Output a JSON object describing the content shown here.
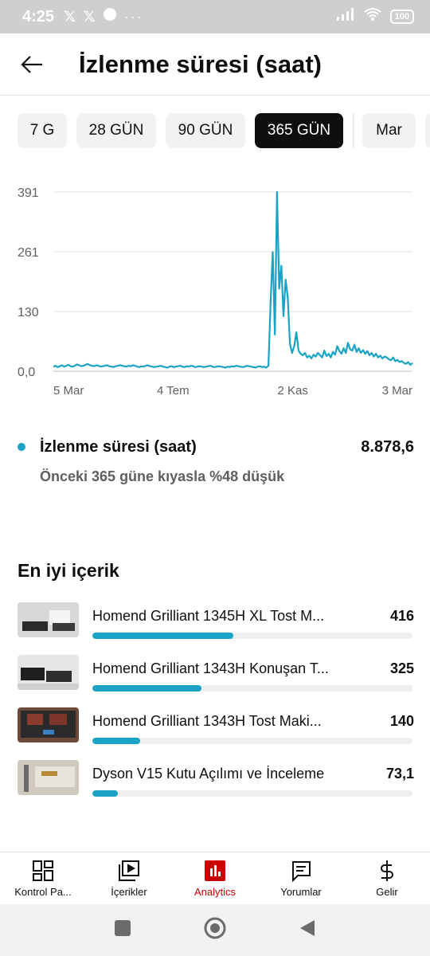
{
  "status_bar": {
    "time": "4:25",
    "x_icon_1": "𝕏",
    "x_icon_2": "𝕏",
    "more": "···",
    "battery": "100"
  },
  "header": {
    "title": "İzlenme süresi (saat)"
  },
  "chips": [
    {
      "label": "7 G",
      "active": false
    },
    {
      "label": "28 GÜN",
      "active": false
    },
    {
      "label": "90 GÜN",
      "active": false
    },
    {
      "label": "365 GÜN",
      "active": true
    },
    {
      "label": "Mar",
      "active": false
    }
  ],
  "chart_data": {
    "type": "line",
    "title": "",
    "xlabel": "",
    "ylabel": "",
    "y_ticks": [
      "391",
      "261",
      "130",
      "0,0"
    ],
    "x_ticks": [
      "5 Mar",
      "4 Tem",
      "2 Kas",
      "3 Mar"
    ],
    "ylim": [
      0,
      391
    ],
    "grid": true,
    "color": "#1aa3c4",
    "series": [
      {
        "values": [
          10,
          12,
          9,
          11,
          13,
          10,
          12,
          14,
          11,
          10,
          12,
          15,
          13,
          11,
          12,
          14,
          16,
          13,
          12,
          11,
          13,
          12,
          10,
          11,
          12,
          13,
          11,
          10,
          9,
          11,
          12,
          13,
          12,
          11,
          10,
          12,
          11,
          13,
          12,
          10,
          9,
          11,
          10,
          12,
          13,
          11,
          10,
          9,
          10,
          11,
          12,
          10,
          9,
          8,
          10,
          11,
          9,
          10,
          11,
          12,
          10,
          9,
          11,
          10,
          12,
          11,
          9,
          10,
          11,
          10,
          9,
          10,
          11,
          12,
          10,
          9,
          10,
          11,
          10,
          9,
          8,
          10,
          9,
          11,
          10,
          12,
          11,
          10,
          9,
          10,
          12,
          11,
          10,
          9,
          8,
          10,
          11,
          9,
          10,
          8,
          12,
          150,
          260,
          80,
          391,
          180,
          230,
          120,
          200,
          160,
          60,
          40,
          55,
          85,
          45,
          38,
          35,
          40,
          30,
          34,
          28,
          36,
          32,
          40,
          35,
          30,
          45,
          33,
          38,
          30,
          42,
          36,
          55,
          44,
          38,
          50,
          40,
          62,
          48,
          45,
          58,
          42,
          50,
          40,
          46,
          38,
          44,
          35,
          40,
          32,
          38,
          30,
          34,
          28,
          32,
          30,
          26,
          24,
          30,
          22,
          25,
          20,
          22,
          18,
          16,
          20,
          14,
          18
        ]
      }
    ]
  },
  "legend": {
    "name": "İzlenme süresi (saat)",
    "value": "8.878,6",
    "comparison": "Önceki 365 güne kıyasla %48 düşük"
  },
  "top_content": {
    "title": "En iyi içerik",
    "items": [
      {
        "title": "Homend Grilliant 1345H XL Tost M...",
        "value": "416",
        "share": 0.44
      },
      {
        "title": "Homend Grilliant 1343H Konuşan T...",
        "value": "325",
        "share": 0.34
      },
      {
        "title": "Homend Grilliant 1343H Tost Maki...",
        "value": "140",
        "share": 0.15
      },
      {
        "title": "Dyson V15 Kutu Açılımı ve İnceleme",
        "value": "73,1",
        "share": 0.08
      }
    ]
  },
  "bottom_nav": [
    {
      "label": "Kontrol Pa...",
      "icon": "dashboard-icon",
      "active": false
    },
    {
      "label": "İçerikler",
      "icon": "content-icon",
      "active": false
    },
    {
      "label": "Analytics",
      "icon": "analytics-icon",
      "active": true
    },
    {
      "label": "Yorumlar",
      "icon": "comments-icon",
      "active": false
    },
    {
      "label": "Gelir",
      "icon": "earn-icon",
      "active": false
    }
  ]
}
